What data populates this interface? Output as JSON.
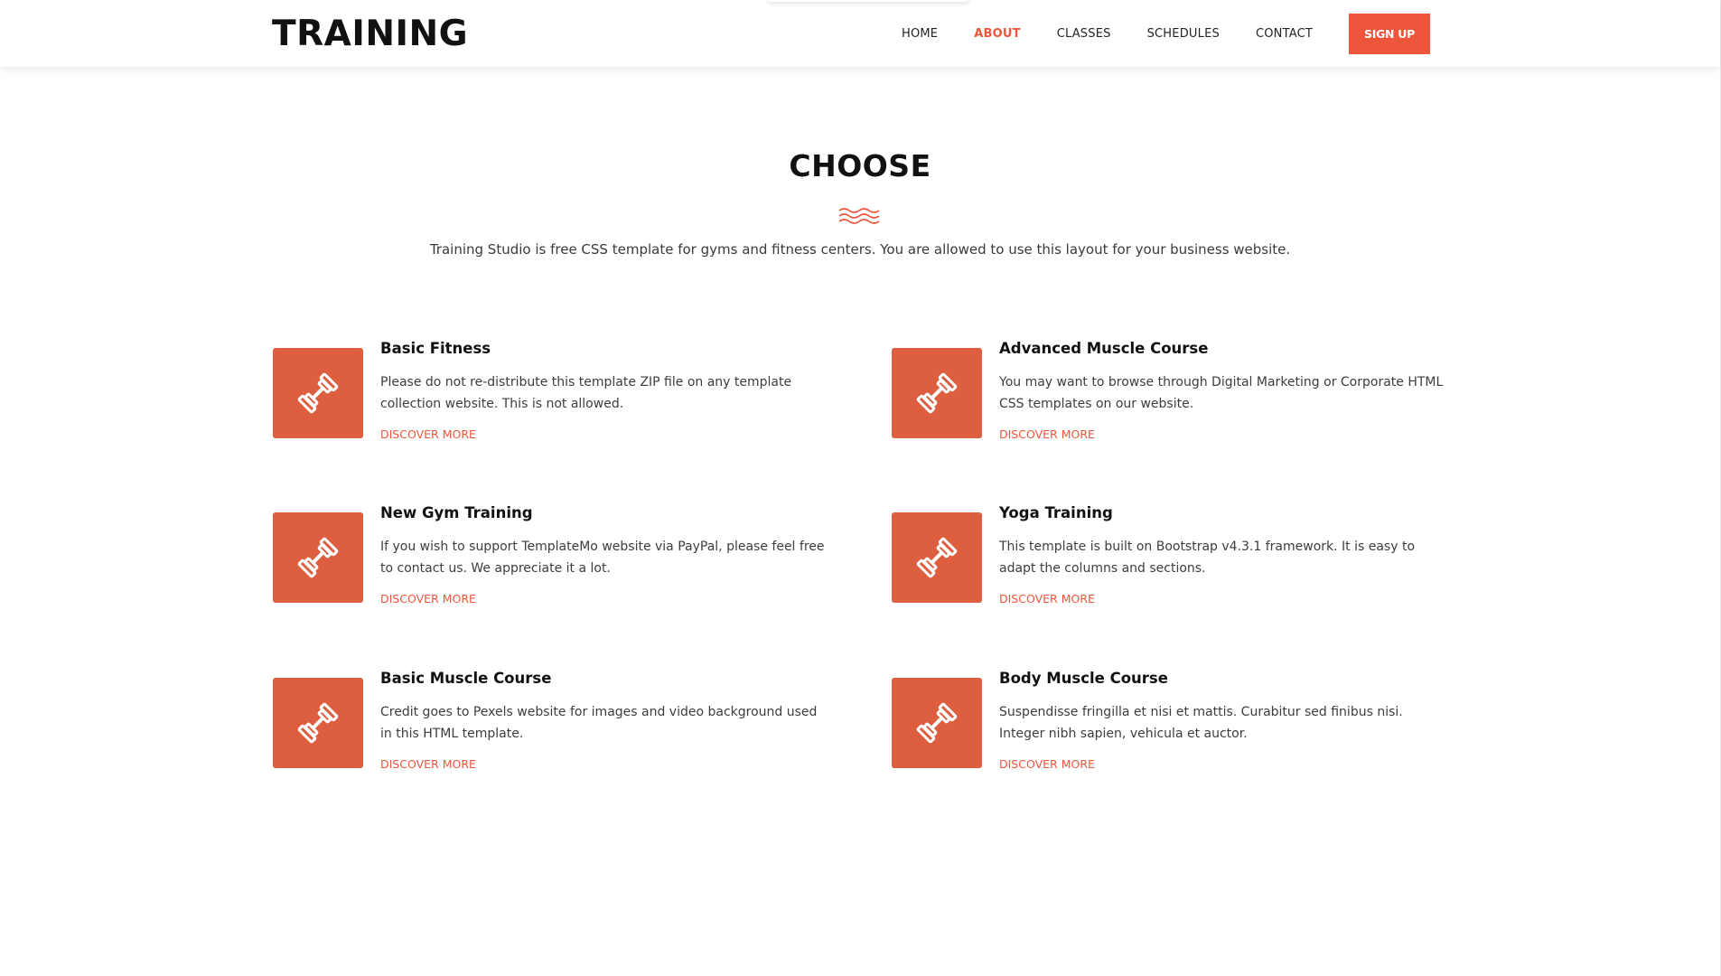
{
  "brand": {
    "logo_text": "TRAINING"
  },
  "nav": {
    "items": [
      {
        "label": "HOME",
        "active": false
      },
      {
        "label": "ABOUT",
        "active": true
      },
      {
        "label": "CLASSES",
        "active": false
      },
      {
        "label": "SCHEDULES",
        "active": false
      },
      {
        "label": "CONTACT",
        "active": false
      }
    ],
    "signup_label": "SIGN UP"
  },
  "section": {
    "title": "CHOOSE",
    "divider_icon": "waves-icon",
    "description": "Training Studio is free CSS template for gyms and fitness centers. You are allowed to use this layout for your business website."
  },
  "features": [
    {
      "icon": "dumbbell-icon",
      "title": "Basic Fitness",
      "text": "Please do not re-distribute this template ZIP file on any template collection website. This is not allowed.",
      "link": "DISCOVER MORE"
    },
    {
      "icon": "dumbbell-icon",
      "title": "Advanced Muscle Course",
      "text": "You may want to browse through Digital Marketing or Corporate HTML CSS templates on our website.",
      "link": "DISCOVER MORE"
    },
    {
      "icon": "dumbbell-icon",
      "title": "New Gym Training",
      "text": "If you wish to support TemplateMo website via PayPal, please feel free to contact us. We appreciate it a lot.",
      "link": "DISCOVER MORE"
    },
    {
      "icon": "dumbbell-icon",
      "title": "Yoga Training",
      "text": "This template is built on Bootstrap v4.3.1 framework. It is easy to adapt the columns and sections.",
      "link": "DISCOVER MORE"
    },
    {
      "icon": "dumbbell-icon",
      "title": "Basic Muscle Course",
      "text": "Credit goes to Pexels website for images and video background used in this HTML template.",
      "link": "DISCOVER MORE"
    },
    {
      "icon": "dumbbell-icon",
      "title": "Body Muscle Course",
      "text": "Suspendisse fringilla et nisi et mattis. Curabitur sed finibus nisi. Integer nibh sapien, vehicula et auctor.",
      "link": "DISCOVER MORE"
    }
  ],
  "colors": {
    "accent": "#ed563b",
    "icon_box": "#dd5f3f",
    "text_dark": "#111111",
    "text_body": "#3d3d3d"
  }
}
